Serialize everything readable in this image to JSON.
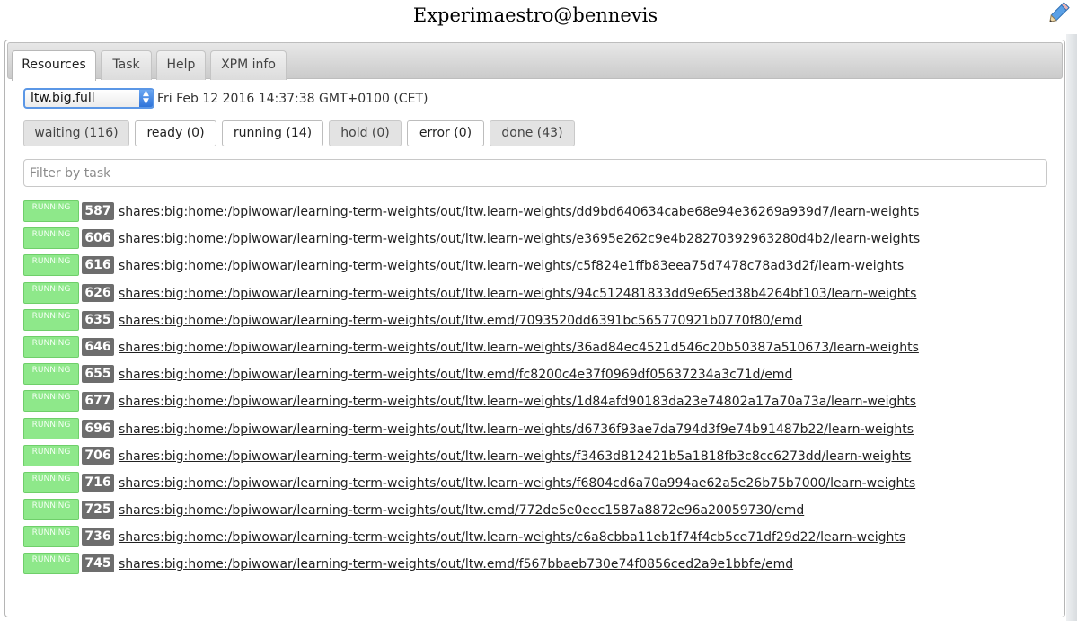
{
  "header": {
    "title": "Experimaestro@bennevis"
  },
  "tabs": [
    {
      "label": "Resources",
      "active": true
    },
    {
      "label": "Task",
      "active": false
    },
    {
      "label": "Help",
      "active": false
    },
    {
      "label": "XPM info",
      "active": false
    }
  ],
  "resources": {
    "task_select": {
      "value": "ltw.big.full"
    },
    "timestamp": "Fri Feb 12 2016 14:37:38 GMT+0100 (CET)",
    "filters": [
      {
        "label": "waiting (116)",
        "pressed": true
      },
      {
        "label": "ready (0)",
        "pressed": false
      },
      {
        "label": "running (14)",
        "pressed": false
      },
      {
        "label": "hold (0)",
        "pressed": true
      },
      {
        "label": "error (0)",
        "pressed": false
      },
      {
        "label": "done (43)",
        "pressed": true
      }
    ],
    "filter_placeholder": "Filter by task",
    "jobs": [
      {
        "state": "RUNNING",
        "id": "587",
        "path": "shares:big:home:/bpiwowar/learning-term-weights/out/ltw.learn-weights/dd9bd640634cabe68e94e36269a939d7/learn-weights"
      },
      {
        "state": "RUNNING",
        "id": "606",
        "path": "shares:big:home:/bpiwowar/learning-term-weights/out/ltw.learn-weights/e3695e262c9e4b28270392963280d4b2/learn-weights"
      },
      {
        "state": "RUNNING",
        "id": "616",
        "path": "shares:big:home:/bpiwowar/learning-term-weights/out/ltw.learn-weights/c5f824e1ffb83eea75d7478c78ad3d2f/learn-weights"
      },
      {
        "state": "RUNNING",
        "id": "626",
        "path": "shares:big:home:/bpiwowar/learning-term-weights/out/ltw.learn-weights/94c512481833dd9e65ed38b4264bf103/learn-weights"
      },
      {
        "state": "RUNNING",
        "id": "635",
        "path": "shares:big:home:/bpiwowar/learning-term-weights/out/ltw.emd/7093520dd6391bc565770921b0770f80/emd"
      },
      {
        "state": "RUNNING",
        "id": "646",
        "path": "shares:big:home:/bpiwowar/learning-term-weights/out/ltw.learn-weights/36ad84ec4521d546c20b50387a510673/learn-weights"
      },
      {
        "state": "RUNNING",
        "id": "655",
        "path": "shares:big:home:/bpiwowar/learning-term-weights/out/ltw.emd/fc8200c4e37f0969df05637234a3c71d/emd"
      },
      {
        "state": "RUNNING",
        "id": "677",
        "path": "shares:big:home:/bpiwowar/learning-term-weights/out/ltw.learn-weights/1d84afd90183da23e74802a17a70a73a/learn-weights"
      },
      {
        "state": "RUNNING",
        "id": "696",
        "path": "shares:big:home:/bpiwowar/learning-term-weights/out/ltw.learn-weights/d6736f93ae7da794d3f9e74b91487b22/learn-weights"
      },
      {
        "state": "RUNNING",
        "id": "706",
        "path": "shares:big:home:/bpiwowar/learning-term-weights/out/ltw.learn-weights/f3463d812421b5a1818fb3c8cc6273dd/learn-weights"
      },
      {
        "state": "RUNNING",
        "id": "716",
        "path": "shares:big:home:/bpiwowar/learning-term-weights/out/ltw.learn-weights/f6804cd6a70a994ae62a5e26b75b7000/learn-weights"
      },
      {
        "state": "RUNNING",
        "id": "725",
        "path": "shares:big:home:/bpiwowar/learning-term-weights/out/ltw.emd/772de5e0eec1587a8872e96a20059730/emd"
      },
      {
        "state": "RUNNING",
        "id": "736",
        "path": "shares:big:home:/bpiwowar/learning-term-weights/out/ltw.learn-weights/c6a8cbba11eb1f74f4cb5ce71df29d22/learn-weights"
      },
      {
        "state": "RUNNING",
        "id": "745",
        "path": "shares:big:home:/bpiwowar/learning-term-weights/out/ltw.emd/f567bbaeb730e74f0856ced2a9e1bbfe/emd"
      }
    ]
  },
  "icons": {
    "corner": "pencil-icon",
    "select_arrow": "chevron-up-down-icon"
  },
  "colors": {
    "running_badge": "#8ee88a",
    "job_id_badge": "#6d6d6d",
    "select_focus": "#5b97e6"
  }
}
